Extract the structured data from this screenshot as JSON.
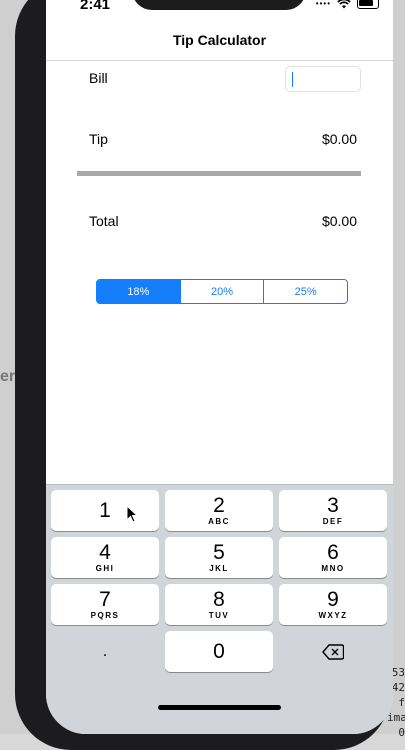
{
  "status_bar": {
    "time": "2:41"
  },
  "nav": {
    "title": "Tip Calculator"
  },
  "bill": {
    "label": "Bill",
    "value": ""
  },
  "tip": {
    "label": "Tip",
    "value": "$0.00"
  },
  "total": {
    "label": "Total",
    "value": "$0.00"
  },
  "tip_selector": {
    "options": [
      "18%",
      "20%",
      "25%"
    ],
    "selected": "18%"
  },
  "keypad": {
    "keys": [
      {
        "digit": "1",
        "letters": ""
      },
      {
        "digit": "2",
        "letters": "ABC"
      },
      {
        "digit": "3",
        "letters": "DEF"
      },
      {
        "digit": "4",
        "letters": "GHI"
      },
      {
        "digit": "5",
        "letters": "JKL"
      },
      {
        "digit": "6",
        "letters": "MNO"
      },
      {
        "digit": "7",
        "letters": "PQRS"
      },
      {
        "digit": "8",
        "letters": "TUV"
      },
      {
        "digit": "9",
        "letters": "WXYZ"
      },
      {
        "digit": ".",
        "letters": ""
      },
      {
        "digit": "0",
        "letters": ""
      }
    ],
    "backspace_icon": "backspace-icon"
  },
  "host": {
    "peek_text": "er",
    "console_lines": [
      "53",
      "42",
      "f",
      "ima",
      "0"
    ]
  },
  "colors": {
    "accent": "#147efb",
    "keyboard_bg": "#d1d4d9",
    "divider": "#a8a8a8"
  }
}
